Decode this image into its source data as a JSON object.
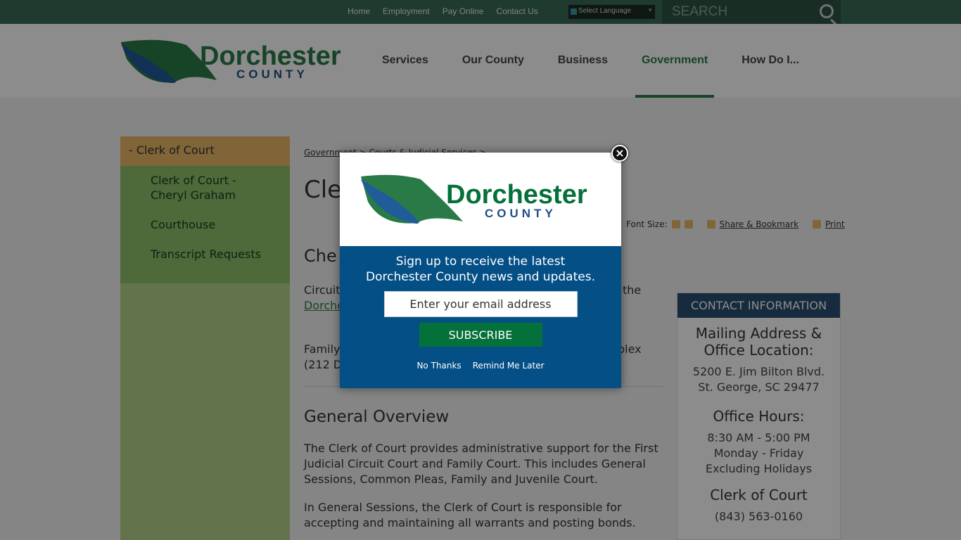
{
  "topbar": {
    "links": [
      "Home",
      "Employment",
      "Pay Online",
      "Contact Us"
    ],
    "language": "Select Language",
    "search_placeholder": "SEARCH"
  },
  "logo": {
    "name": "Dorchester",
    "sub": "COUNTY"
  },
  "nav": [
    "Services",
    "Our County",
    "Business",
    "Government",
    "How Do I..."
  ],
  "sidebar": {
    "head": "Clerk of Court",
    "items": [
      "Clerk of Court - Cheryl Graham",
      "Courthouse",
      "Transcript Requests"
    ]
  },
  "content": {
    "breadcrumb": "Government > Courts & Judicial Services >",
    "title_fragment": "Cle",
    "subhead_fragment": "Che",
    "p1_start": "Circuit",
    "p1_end": "the",
    "p1_link": "Dorche",
    "p2_start": "Family",
    "p2_end": "plex",
    "p2_line2": "(212 D",
    "section": "General Overview",
    "para1": "The Clerk of Court provides administrative support for the First Judicial Circuit Court and Family Court. This includes General Sessions, Common Pleas, Family and Juvenile Court.",
    "para2": "In General Sessions, the Clerk of Court is responsible for accepting and maintaining all warrants and posting bonds."
  },
  "tools": {
    "font_size": "Font Size:",
    "share": "Share & Bookmark",
    "print": "Print"
  },
  "contact": {
    "header": "CONTACT INFORMATION",
    "mail_title": "Mailing Address & Office Location:",
    "address1": "5200 E. Jim Bilton Blvd.",
    "address2": "St. George, SC 29477",
    "hours_title": "Office Hours:",
    "hours1": "8:30 AM - 5:00 PM",
    "hours2": "Monday - Friday",
    "hours3": "Excluding Holidays",
    "dept": "Clerk of Court",
    "phone": "(843) 563-0160"
  },
  "modal": {
    "line1": "Sign up to receive the latest",
    "line2": "Dorchester County news and updates.",
    "email_placeholder": "Enter your email address",
    "subscribe": "SUBSCRIBE",
    "no_thanks": "No Thanks",
    "remind": "Remind Me Later"
  },
  "colors": {
    "green": "#2a7a48",
    "blue": "#044f86",
    "gold": "#e8b866"
  }
}
